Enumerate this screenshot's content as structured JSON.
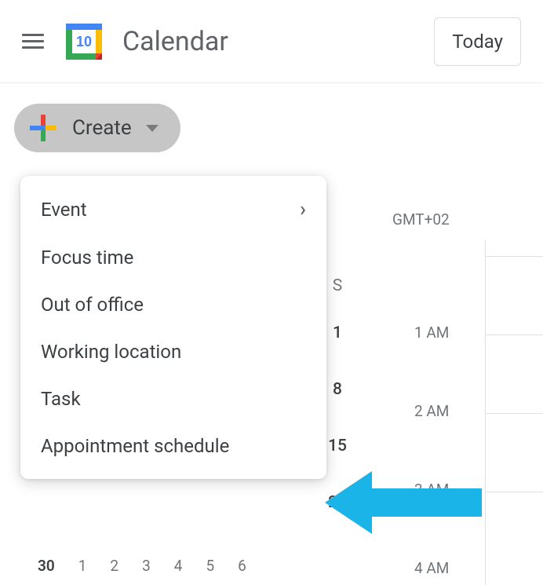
{
  "header": {
    "app_title": "Calendar",
    "today_label": "Today",
    "logo_day": "10"
  },
  "create": {
    "label": "Create",
    "menu": [
      {
        "label": "Event",
        "has_submenu": true
      },
      {
        "label": "Focus time",
        "has_submenu": false
      },
      {
        "label": "Out of office",
        "has_submenu": false
      },
      {
        "label": "Working location",
        "has_submenu": false
      },
      {
        "label": "Task",
        "has_submenu": false
      },
      {
        "label": "Appointment schedule",
        "has_submenu": false
      }
    ]
  },
  "calendar": {
    "timezone": "GMT+02",
    "day_header": "S",
    "visible_dates": [
      "1",
      "8",
      "15",
      "22"
    ],
    "time_labels": [
      "1 AM",
      "2 AM",
      "3 AM",
      "4 AM"
    ],
    "mini_row": [
      "30",
      "1",
      "2",
      "3",
      "4",
      "5",
      "6"
    ]
  },
  "colors": {
    "google_blue": "#4285F4",
    "google_red": "#EA4335",
    "google_yellow": "#FBBC04",
    "google_green": "#34A853",
    "arrow": "#1BB4E8"
  }
}
